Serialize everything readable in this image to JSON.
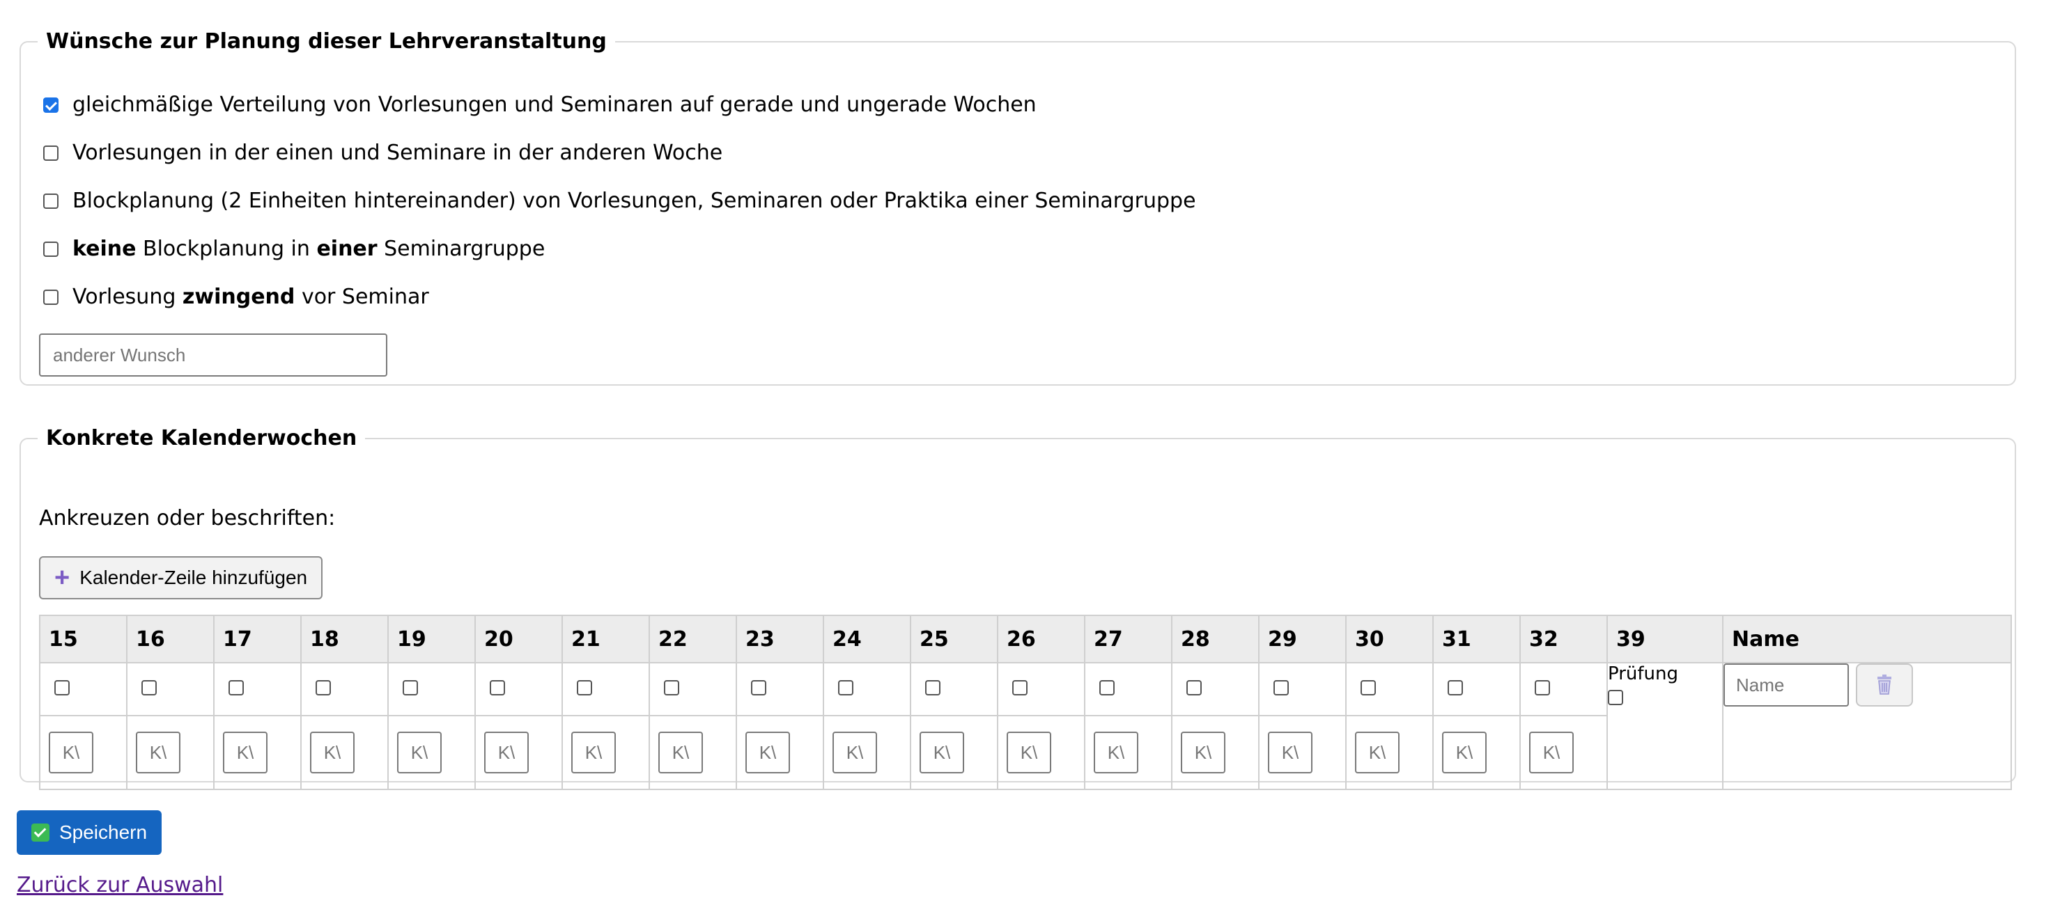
{
  "wishes": {
    "legend": "Wünsche zur Planung dieser Lehrveranstaltung",
    "options": [
      {
        "parts": [
          "gleichmäßige Verteilung von Vorlesungen und Seminaren auf gerade und ungerade Wochen"
        ],
        "checked": true
      },
      {
        "parts": [
          "Vorlesungen in der einen und Seminare in der anderen Woche"
        ],
        "checked": false
      },
      {
        "parts": [
          "Blockplanung (2 Einheiten hintereinander) von Vorlesungen, Seminaren oder Praktika einer Seminargruppe"
        ],
        "checked": false
      },
      {
        "parts": [
          "keine",
          " Blockplanung in ",
          "einer",
          " Seminargruppe"
        ],
        "checked": false
      },
      {
        "parts": [
          "Vorlesung ",
          "zwingend",
          " vor Seminar"
        ],
        "checked": false
      }
    ],
    "other_placeholder": "anderer Wunsch",
    "other_value": ""
  },
  "calendar": {
    "legend": "Konkrete Kalenderwochen",
    "hint": "Ankreuzen oder beschriften:",
    "add_row_label": "Kalender-Zeile hinzufügen",
    "weeks": [
      "15",
      "16",
      "17",
      "18",
      "19",
      "20",
      "21",
      "22",
      "23",
      "24",
      "25",
      "26",
      "27",
      "28",
      "29",
      "30",
      "31",
      "32"
    ],
    "week_checked": [
      false,
      false,
      false,
      false,
      false,
      false,
      false,
      false,
      false,
      false,
      false,
      false,
      false,
      false,
      false,
      false,
      false,
      false
    ],
    "kw_placeholder": "K\\",
    "exam_week": "39",
    "exam_label": "Prüfung",
    "exam_checked": false,
    "name_header": "Name",
    "name_placeholder": "Name"
  },
  "actions": {
    "save_label": "Speichern",
    "back_link": "Zurück zur Auswahl"
  },
  "colors": {
    "primary": "#1565c0",
    "checkbox_checked": "#1a73e8",
    "link": "#551a8b",
    "add_icon": "#7c5cc4"
  }
}
